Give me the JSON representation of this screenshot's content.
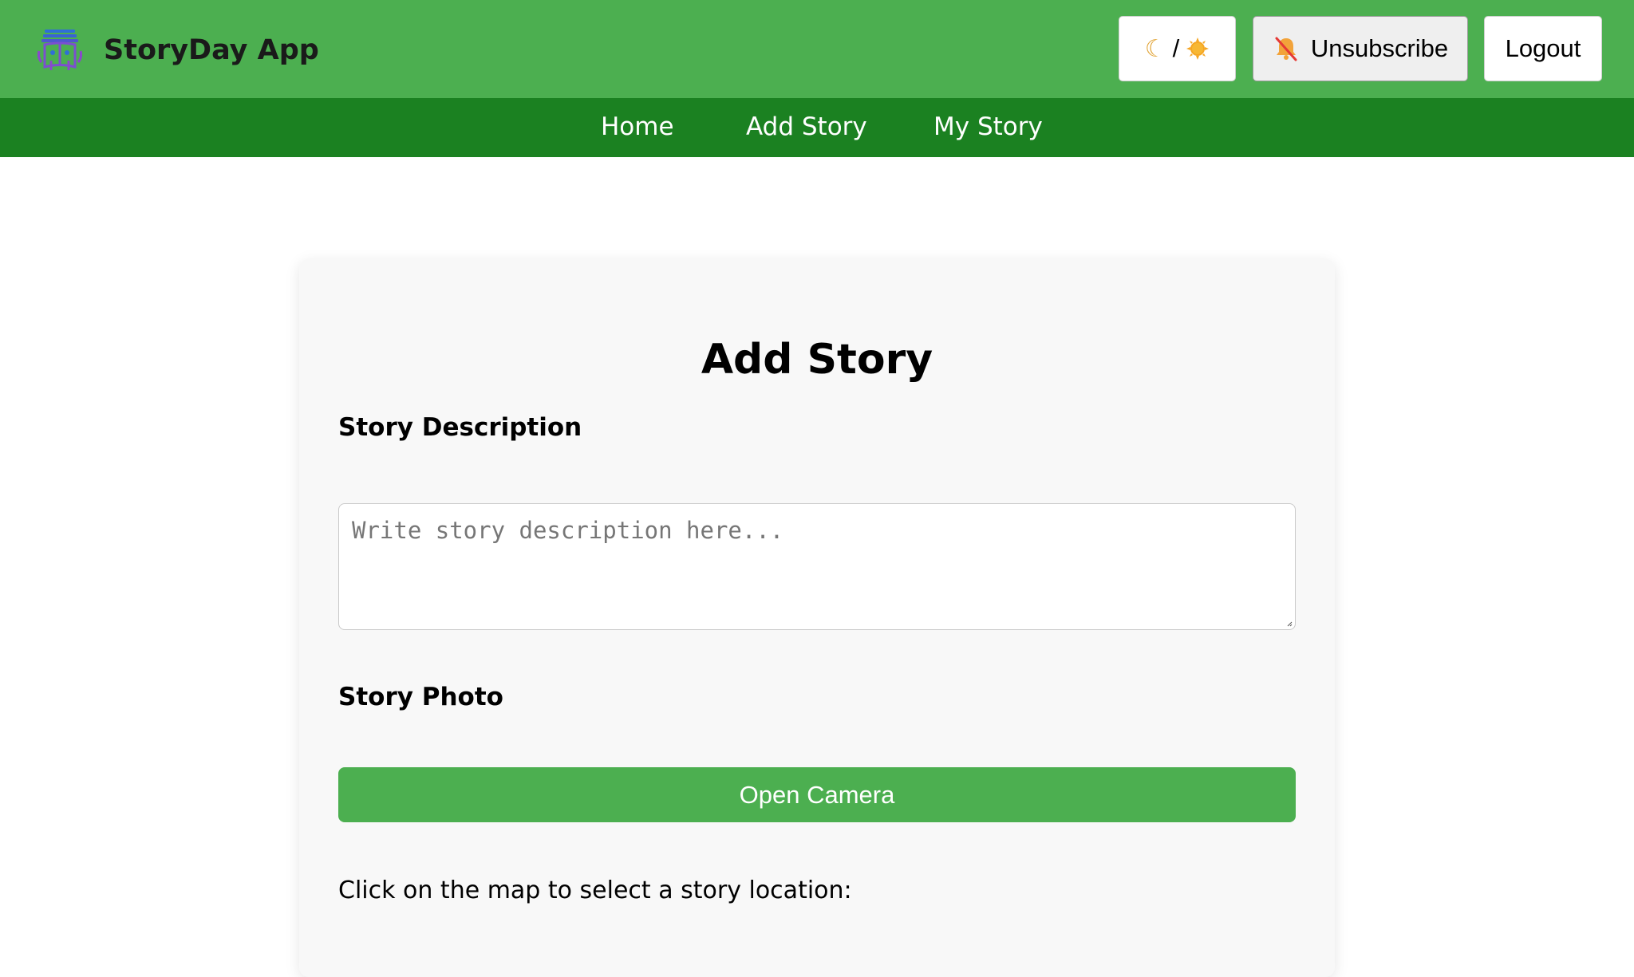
{
  "header": {
    "app_title": "StoryDay App",
    "logo_icon": "book-robot-logo-icon",
    "theme_toggle": {
      "moon_icon": "crescent-moon-icon",
      "separator": "/",
      "sun_icon": "sun-icon"
    },
    "unsubscribe": {
      "icon": "bell-off-icon",
      "label": "Unsubscribe"
    },
    "logout_label": "Logout"
  },
  "nav": {
    "items": [
      {
        "label": "Home"
      },
      {
        "label": "Add Story"
      },
      {
        "label": "My Story"
      }
    ]
  },
  "form": {
    "title": "Add Story",
    "description_label": "Story Description",
    "description_placeholder": "Write story description here...",
    "description_value": "",
    "photo_label": "Story Photo",
    "open_camera_label": "Open Camera",
    "map_hint": "Click on the map to select a story location:"
  },
  "colors": {
    "header_bg": "#4caf50",
    "nav_bg": "#1b8121",
    "accent": "#4caf50",
    "card_bg": "#f8f8f8"
  }
}
